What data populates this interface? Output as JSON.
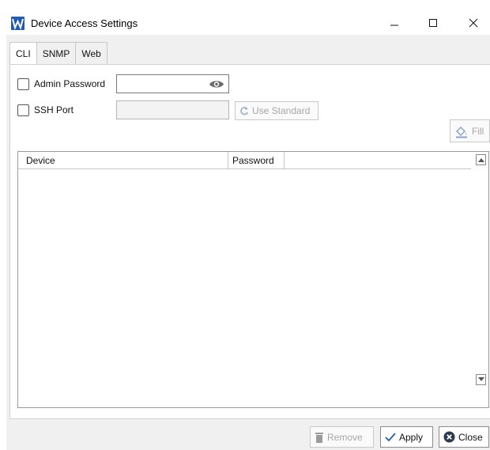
{
  "window": {
    "title": "Device Access Settings",
    "icon": "app-logo-icon",
    "controls": {
      "minimize": "minimize-icon",
      "maximize": "maximize-icon",
      "close": "close-icon"
    }
  },
  "tabs": [
    {
      "label": "CLI",
      "active": true
    },
    {
      "label": "SNMP",
      "active": false
    },
    {
      "label": "Web",
      "active": false
    }
  ],
  "cli": {
    "admin_password": {
      "label": "Admin Password",
      "checked": false,
      "value": "",
      "reveal_icon": "eye-icon"
    },
    "ssh_port": {
      "label": "SSH Port",
      "checked": false,
      "value": "",
      "enabled": false
    },
    "use_standard_label": "Use Standard",
    "fill_label": "Fill"
  },
  "grid": {
    "columns": [
      "Device",
      "Password"
    ],
    "rows": []
  },
  "footer": {
    "remove_label": "Remove",
    "apply_label": "Apply",
    "close_label": "Close"
  },
  "colors": {
    "accent": "#1f5bb8",
    "close_icon_bg": "#2b3b52",
    "disabled_text": "#a6a6a6"
  }
}
